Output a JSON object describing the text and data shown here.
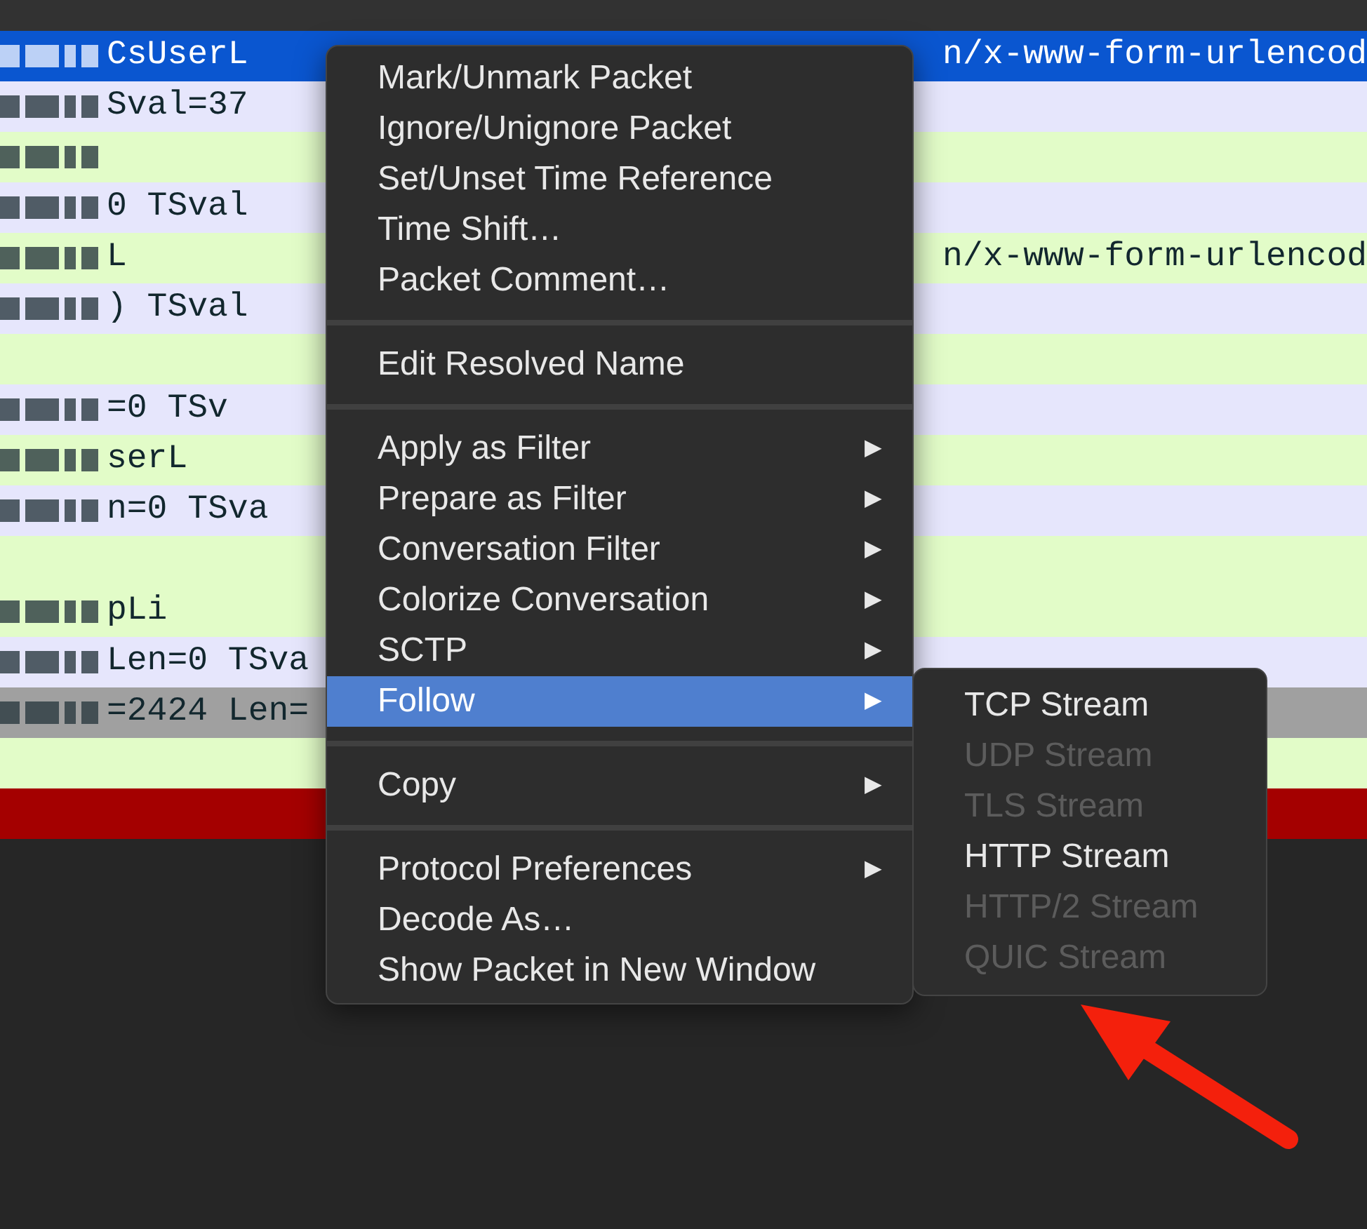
{
  "packet_rows": [
    {
      "selected": true,
      "redacted": true,
      "text": "CsUserL",
      "right_text": "n/x-www-form-urlencod"
    },
    {
      "color": "#e6e6fc",
      "selected": false,
      "redacted": true,
      "text": "Sval=37"
    },
    {
      "color": "#e2fcc8",
      "selected": false,
      "redacted": true
    },
    {
      "color": "#e6e6fc",
      "selected": false,
      "redacted": true,
      "text": "0 TSval"
    },
    {
      "color": "#e2fcc8",
      "selected": false,
      "redacted": true,
      "text": "L",
      "right_text": "n/x-www-form-urlencod"
    },
    {
      "color": "#e6e6fc",
      "selected": false,
      "redacted": true,
      "text": ") TSval"
    },
    {
      "color": "#e2fcc8",
      "selected": false,
      "redacted": false
    },
    {
      "color": "#e6e6fc",
      "selected": false,
      "redacted": true,
      "text": "=0 TSv"
    },
    {
      "color": "#e2fcc8",
      "selected": false,
      "redacted": true,
      "text": "serL"
    },
    {
      "color": "#e6e6fc",
      "selected": false,
      "redacted": true,
      "text": "n=0 TSva"
    },
    {
      "color": "#e2fcc8",
      "selected": false,
      "redacted": false
    },
    {
      "color": "#e2fcc8",
      "selected": false,
      "redacted": true,
      "text": "pLi"
    },
    {
      "color": "#e6e6fc",
      "selected": false,
      "redacted": true,
      "text": "Len=0 TSva"
    },
    {
      "color": "#a0a0a0",
      "selected": false,
      "redacted": true,
      "text": "=2424 Len="
    },
    {
      "color": "#e2fcc8",
      "selected": false,
      "redacted": false
    },
    {
      "color": "#a40000",
      "selected": false,
      "redacted": false
    }
  ],
  "context_menu": [
    {
      "kind": "item",
      "label": "Mark/Unmark Packet",
      "submenu": false,
      "highlighted": false
    },
    {
      "kind": "item",
      "label": "Ignore/Unignore Packet",
      "submenu": false,
      "highlighted": false
    },
    {
      "kind": "item",
      "label": "Set/Unset Time Reference",
      "submenu": false,
      "highlighted": false
    },
    {
      "kind": "item",
      "label": "Time Shift…",
      "submenu": false,
      "highlighted": false
    },
    {
      "kind": "item",
      "label": "Packet Comment…",
      "submenu": false,
      "highlighted": false
    },
    {
      "kind": "separator"
    },
    {
      "kind": "item",
      "label": "Edit Resolved Name",
      "submenu": false,
      "highlighted": false
    },
    {
      "kind": "separator"
    },
    {
      "kind": "item",
      "label": "Apply as Filter",
      "submenu": true,
      "highlighted": false
    },
    {
      "kind": "item",
      "label": "Prepare as Filter",
      "submenu": true,
      "highlighted": false
    },
    {
      "kind": "item",
      "label": "Conversation Filter",
      "submenu": true,
      "highlighted": false
    },
    {
      "kind": "item",
      "label": "Colorize Conversation",
      "submenu": true,
      "highlighted": false
    },
    {
      "kind": "item",
      "label": "SCTP",
      "submenu": true,
      "highlighted": false
    },
    {
      "kind": "item",
      "label": "Follow",
      "submenu": true,
      "highlighted": true
    },
    {
      "kind": "separator"
    },
    {
      "kind": "item",
      "label": "Copy",
      "submenu": true,
      "highlighted": false
    },
    {
      "kind": "separator"
    },
    {
      "kind": "item",
      "label": "Protocol Preferences",
      "submenu": true,
      "highlighted": false
    },
    {
      "kind": "item",
      "label": "Decode As…",
      "submenu": false,
      "highlighted": false
    },
    {
      "kind": "item",
      "label": "Show Packet in New Window",
      "submenu": false,
      "highlighted": false
    }
  ],
  "submenu": [
    {
      "label": "TCP Stream",
      "disabled": false
    },
    {
      "label": "UDP Stream",
      "disabled": true
    },
    {
      "label": "TLS Stream",
      "disabled": true
    },
    {
      "label": "HTTP Stream",
      "disabled": false
    },
    {
      "label": "HTTP/2 Stream",
      "disabled": true
    },
    {
      "label": "QUIC Stream",
      "disabled": true
    }
  ],
  "submenu_arrow": "▶"
}
